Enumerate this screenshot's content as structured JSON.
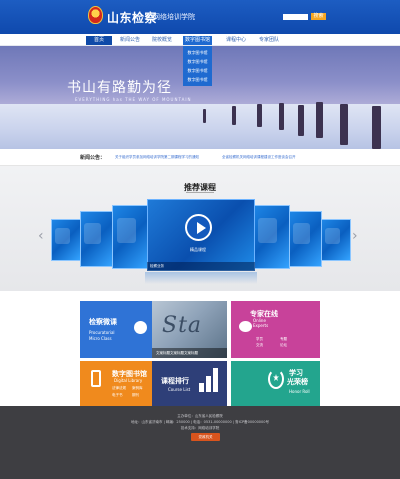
{
  "header": {
    "title": "山东检察",
    "subtitle": "网络培训学院",
    "search_placeholder": "",
    "search_button": "搜索"
  },
  "nav": {
    "items": [
      {
        "label": "首页"
      },
      {
        "label": "新闻公告"
      },
      {
        "label": "院校概览"
      },
      {
        "label": "数字图书馆"
      },
      {
        "label": "课程中心"
      },
      {
        "label": "专家团队"
      }
    ],
    "submenu": [
      "数字图书馆",
      "数字图书馆",
      "数字图书馆",
      "数字图书馆"
    ]
  },
  "banner": {
    "slogan": "书山有路勤为径",
    "slogan_en": "EVERYTHING has THE WAY OF MOUNTAIN",
    "slides": 4,
    "active_slide": 1
  },
  "notice": {
    "label": "新闻公告：",
    "items": [
      "关于组织学员参加网络培训学院第二期课程学习的通知",
      "全省检察机关网络培训课程建设工作座谈会召开"
    ]
  },
  "recommended": {
    "title": "推荐课程",
    "featured_caption": "精品课程",
    "featured_footer": "检察业务"
  },
  "tiles": {
    "micro": {
      "title": "检察微课",
      "en1": "Procuratorial",
      "en2": "Micro Class"
    },
    "photo": {
      "caption": "文案标题文案标题文案标题"
    },
    "expert": {
      "title": "专家在线",
      "en1": "Online",
      "en2": "Experts",
      "link1": "学员",
      "link2": "交流",
      "link3": "专题",
      "link4": "论坛"
    },
    "library": {
      "title": "数字图书馆",
      "en": "Digital Library",
      "l1": "法律法规",
      "l2": "案例库",
      "l3": "电子书",
      "l4": "期刊"
    },
    "course": {
      "title": "课程排行",
      "en": "Course List"
    },
    "honor": {
      "title1": "学习",
      "title2": "光荣榜",
      "en": "Honor Roll"
    }
  },
  "footer": {
    "line1": "主办单位：山东省人民检察院",
    "line2": "地址：山东省济南市 | 邮编：250000 | 电话：0531-00000000 | 鲁ICP备00000000号",
    "line3": "技术支持：网络培训学院",
    "badge": "党政机关"
  },
  "colors": {
    "header": "#1d5dc2",
    "micro": "#2f73d6",
    "expert": "#c8429a",
    "library": "#f08a1d",
    "course": "#2e3f78",
    "honor": "#23a58e",
    "footer": "#3e3e42"
  }
}
